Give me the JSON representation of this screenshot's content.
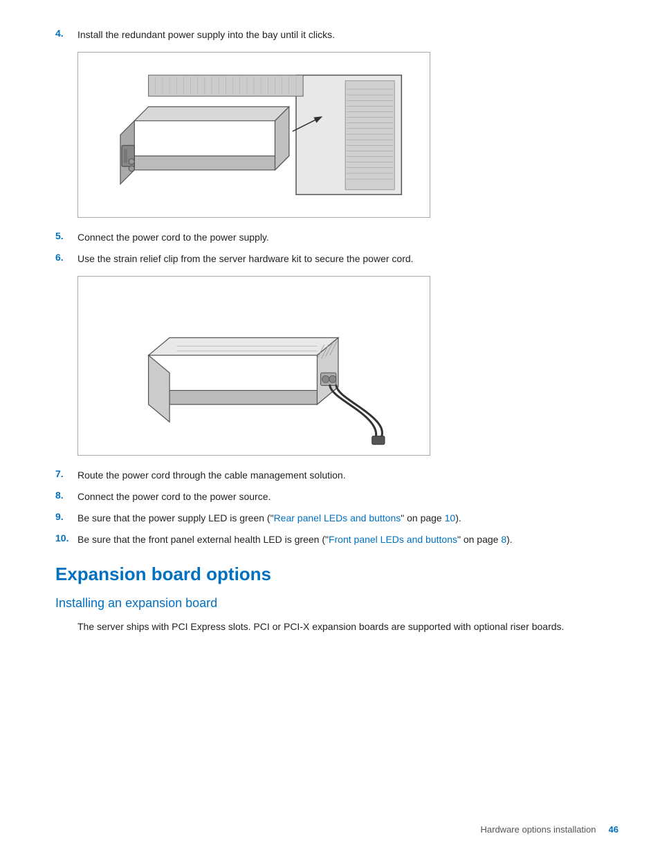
{
  "steps": [
    {
      "num": "4.",
      "text": "Install the redundant power supply into the bay until it clicks."
    },
    {
      "num": "5.",
      "text": "Connect the power cord to the power supply."
    },
    {
      "num": "6.",
      "text": "Use the strain relief clip from the server hardware kit to secure the power cord."
    },
    {
      "num": "7.",
      "text": "Route the power cord through the cable management solution."
    },
    {
      "num": "8.",
      "text": "Connect the power cord to the power source."
    },
    {
      "num": "9.",
      "text_before": "Be sure that the power supply LED is green (\"",
      "link1_text": "Rear panel LEDs and buttons",
      "text_middle": "\" on page ",
      "link2_text": "10",
      "text_after": ")."
    },
    {
      "num": "10.",
      "text_before": "Be sure that the front panel external health LED is green (\"",
      "link1_text": "Front panel LEDs and buttons",
      "text_middle": "\" on page ",
      "link2_text": "8",
      "text_after": ")."
    }
  ],
  "section": {
    "title": "Expansion board options",
    "subsection_title": "Installing an expansion board",
    "body": "The server ships with PCI Express slots. PCI or PCI-X expansion boards are supported with optional riser boards."
  },
  "footer": {
    "label": "Hardware options installation",
    "page": "46"
  }
}
